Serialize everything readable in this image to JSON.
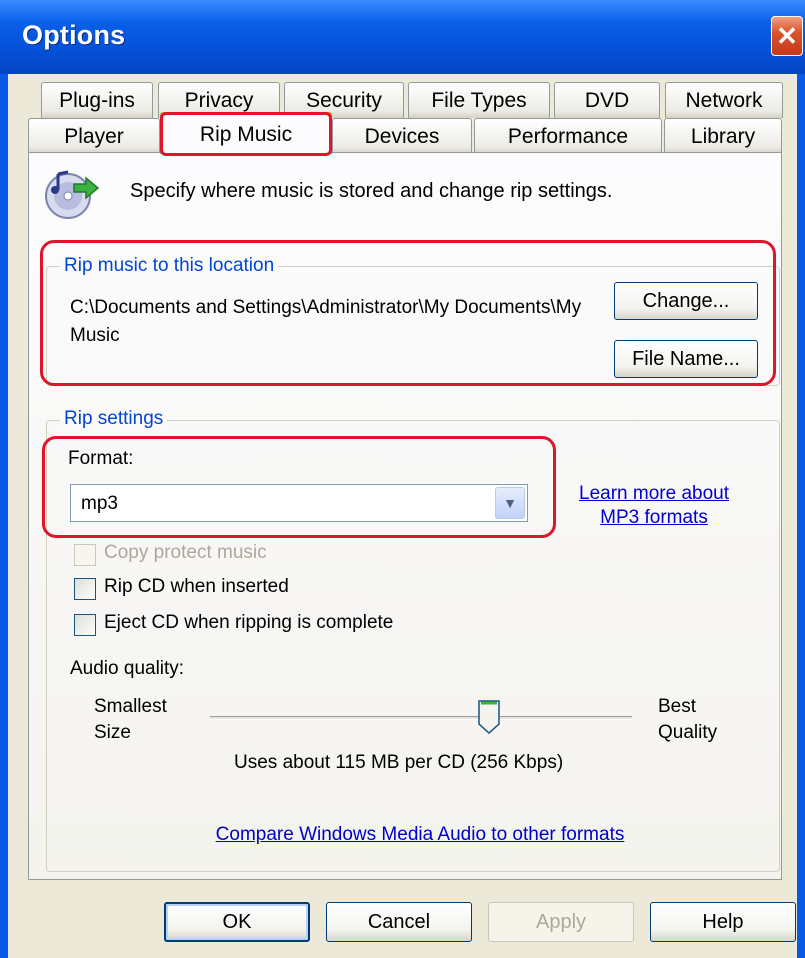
{
  "window": {
    "title": "Options"
  },
  "tabs": {
    "row1": [
      {
        "label": "Plug-ins"
      },
      {
        "label": "Privacy"
      },
      {
        "label": "Security"
      },
      {
        "label": "File Types"
      },
      {
        "label": "DVD"
      },
      {
        "label": "Network"
      }
    ],
    "row2": [
      {
        "label": "Player"
      },
      {
        "label": "Rip Music"
      },
      {
        "label": "Devices"
      },
      {
        "label": "Performance"
      },
      {
        "label": "Library"
      }
    ],
    "active": "Rip Music"
  },
  "header": {
    "text": "Specify where music is stored and change rip settings."
  },
  "location": {
    "group_title": "Rip music to this location",
    "path": "C:\\Documents and Settings\\Administrator\\My Documents\\My Music",
    "change_label": "Change...",
    "filename_label": "File Name..."
  },
  "rip_settings": {
    "group_title": "Rip settings",
    "format_label": "Format:",
    "format_value": "mp3",
    "learn_more_line1": "Learn more about",
    "learn_more_line2": "MP3 formats",
    "copy_protect_label": "Copy protect music",
    "rip_cd_label": "Rip CD when inserted",
    "eject_cd_label": "Eject CD when ripping is complete",
    "audio_quality_label": "Audio quality:",
    "smallest_line1": "Smallest",
    "smallest_line2": "Size",
    "best_line1": "Best",
    "best_line2": "Quality",
    "quality_fraction": 0.66,
    "usage_text": "Uses about 115 MB per CD (256 Kbps)",
    "compare_link": "Compare Windows Media Audio to other formats"
  },
  "buttons": {
    "ok": "OK",
    "cancel": "Cancel",
    "apply": "Apply",
    "help": "Help"
  },
  "colors": {
    "titlebar": "#0a5fe8",
    "highlight": "#e0152c",
    "link": "#0000cc",
    "group_title": "#0046d5"
  }
}
